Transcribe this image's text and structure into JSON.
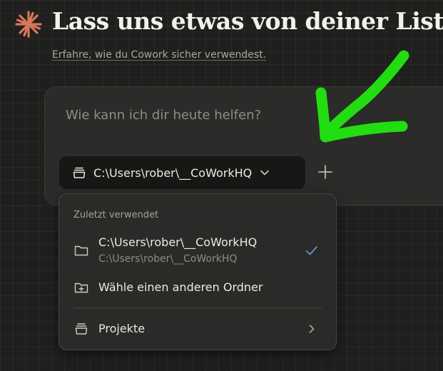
{
  "header": {
    "logo_icon": "sparkle-asterisk-icon",
    "title": "Lass uns etwas von deiner Liste",
    "subtitle_link": "Erfahre, wie du Cowork sicher verwendest."
  },
  "composer": {
    "placeholder": "Wie kann ich dir heute helfen?",
    "folder_chip": {
      "icon": "folder-stack-icon",
      "label": "C:\\Users\\rober\\__CoWorkHQ"
    },
    "add_icon": "plus-icon"
  },
  "dropdown": {
    "section_label": "Zuletzt verwendet",
    "recent_folder": {
      "icon": "folder-icon",
      "title": "C:\\Users\\rober\\__CoWorkHQ",
      "path": "C:\\Users\\rober\\__CoWorkHQ",
      "selected": true
    },
    "choose_other": {
      "icon": "folder-plus-icon",
      "label": "Wähle einen anderen Ordner"
    },
    "projects": {
      "icon": "folder-stack-icon",
      "label": "Projekte"
    }
  },
  "colors": {
    "accent_logo": "#d9775a",
    "annotation_arrow": "#22dd11",
    "check": "#6f93c9"
  }
}
